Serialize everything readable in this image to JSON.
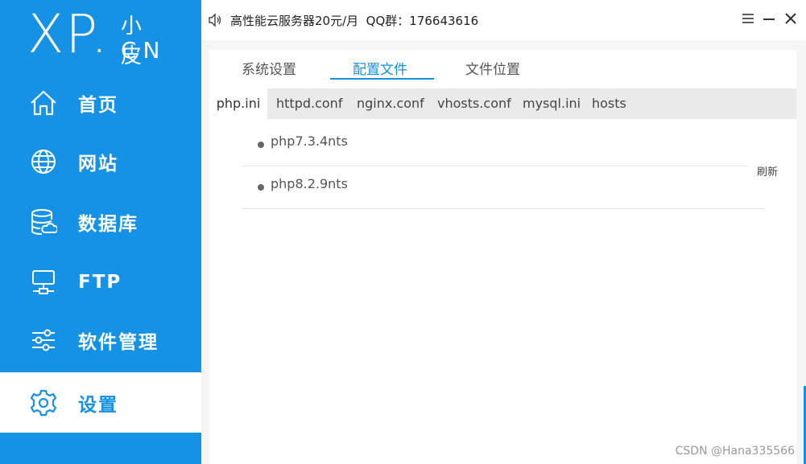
{
  "logo": {
    "main": "XP.",
    "cn_top": "小皮",
    "cn_bottom": "CN"
  },
  "sidebar": {
    "items": [
      {
        "label": "首页",
        "icon": "home-icon"
      },
      {
        "label": "网站",
        "icon": "globe-icon"
      },
      {
        "label": "数据库",
        "icon": "database-icon"
      },
      {
        "label": "FTP",
        "icon": "ftp-server-icon"
      },
      {
        "label": "软件管理",
        "icon": "sliders-icon"
      },
      {
        "label": "设置",
        "icon": "gear-icon",
        "active": true
      }
    ]
  },
  "titlebar": {
    "title": "高性能云服务器20元/月  QQ群：176643616"
  },
  "tabs": [
    "系统设置",
    "配置文件",
    "文件位置"
  ],
  "subtabs": [
    "php.ini",
    "httpd.conf",
    "nginx.conf",
    "vhosts.conf",
    "mysql.ini",
    "hosts"
  ],
  "list": [
    "php7.3.4nts",
    "php8.2.9nts"
  ],
  "refresh_label": "刷新",
  "watermark": "CSDN @Hana335566",
  "colors": {
    "primary": "#1591e6",
    "sidebar_text": "#ffffff"
  }
}
